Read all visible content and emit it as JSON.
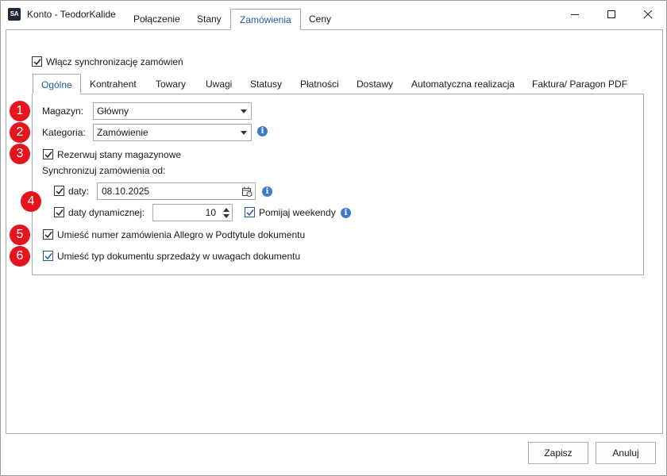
{
  "window": {
    "app_icon_text": "SA",
    "title": "Konto - TeodorKalide"
  },
  "top_tabs": [
    {
      "label": "Połączenie"
    },
    {
      "label": "Stany"
    },
    {
      "label": "Zamówienia",
      "active": true
    },
    {
      "label": "Ceny"
    }
  ],
  "sync": {
    "enable_label": "Włącz synchronizację zamówień",
    "enabled": true
  },
  "inner_tabs": [
    {
      "label": "Ogólne",
      "active": true
    },
    {
      "label": "Kontrahent"
    },
    {
      "label": "Towary"
    },
    {
      "label": "Uwagi"
    },
    {
      "label": "Statusy"
    },
    {
      "label": "Płatności"
    },
    {
      "label": "Dostawy"
    },
    {
      "label": "Automatyczna realizacja"
    },
    {
      "label": "Faktura/ Paragon PDF"
    }
  ],
  "general": {
    "magazyn_label": "Magazyn:",
    "magazyn_value": "Główny",
    "kategoria_label": "Kategoria:",
    "kategoria_value": "Zamówienie",
    "reserve_label": "Rezerwuj stany magazynowe",
    "sync_from_label": "Synchronizuj zamówienia od:",
    "date_label": "daty:",
    "date_value": "08.10.2025",
    "dynamic_label": "daty dynamicznej:",
    "dynamic_value": "10",
    "skip_weekends_label": "Pomijaj weekendy",
    "allegro_subtitle_label": "Umieść numer zamówienia Allegro w Podtytule dokumentu",
    "doc_type_notes_label": "Umieść typ dokumentu sprzedaży w uwagach dokumentu"
  },
  "badges": [
    "1",
    "2",
    "3",
    "4",
    "5",
    "6"
  ],
  "footer": {
    "save_label": "Zapisz",
    "cancel_label": "Anuluj"
  },
  "icons": {
    "info": "info-icon",
    "calendar": "calendar-icon",
    "check": "check-icon"
  },
  "colors": {
    "accent": "#1f5aa6",
    "badge": "#e6141c",
    "info": "#3d7cc9"
  }
}
